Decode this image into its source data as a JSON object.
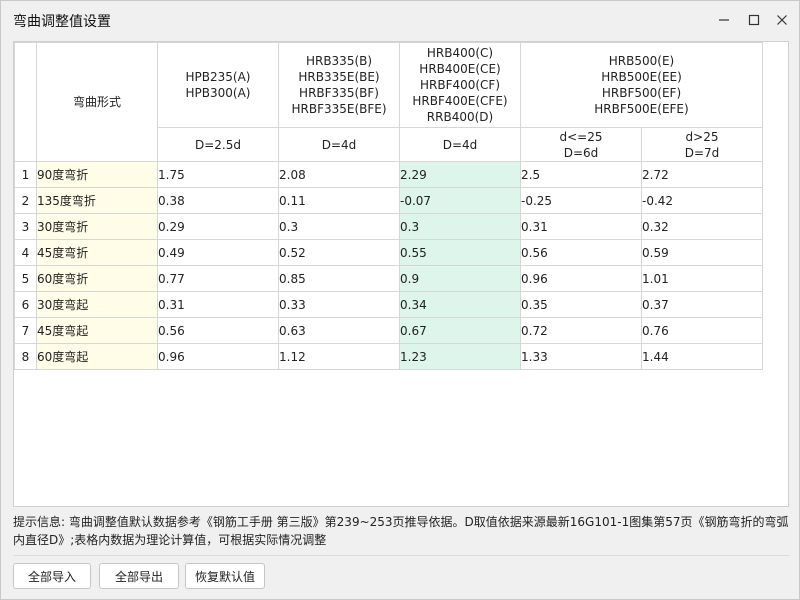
{
  "window": {
    "title": "弯曲调整值设置",
    "minimize_icon": "minimize-icon",
    "maximize_icon": "maximize-icon",
    "close_icon": "close-icon"
  },
  "table": {
    "form_header": "弯曲形式",
    "groups": [
      {
        "label": "HPB235(A)\nHPB300(A)"
      },
      {
        "label": "HRB335(B)\nHRB335E(BE)\nHRBF335(BF)\nHRBF335E(BFE)"
      },
      {
        "label": "HRB400(C)\nHRB400E(CE)\nHRBF400(CF)\nHRBF400E(CFE)\nRRB400(D)"
      },
      {
        "label": "HRB500(E)\nHRB500E(EE)\nHRBF500(EF)\nHRBF500E(EFE)"
      }
    ],
    "sub_headers": [
      "D=2.5d",
      "D=4d",
      "D=4d",
      "d<=25\nD=6d",
      "d>25\nD=7d"
    ],
    "rows": [
      {
        "num": "1",
        "form": "90度弯折",
        "values": [
          "1.75",
          "2.08",
          "2.29",
          "2.5",
          "2.72"
        ]
      },
      {
        "num": "2",
        "form": "135度弯折",
        "values": [
          "0.38",
          "0.11",
          "-0.07",
          "-0.25",
          "-0.42"
        ]
      },
      {
        "num": "3",
        "form": "30度弯折",
        "values": [
          "0.29",
          "0.3",
          "0.3",
          "0.31",
          "0.32"
        ]
      },
      {
        "num": "4",
        "form": "45度弯折",
        "values": [
          "0.49",
          "0.52",
          "0.55",
          "0.56",
          "0.59"
        ]
      },
      {
        "num": "5",
        "form": "60度弯折",
        "values": [
          "0.77",
          "0.85",
          "0.9",
          "0.96",
          "1.01"
        ]
      },
      {
        "num": "6",
        "form": "30度弯起",
        "values": [
          "0.31",
          "0.33",
          "0.34",
          "0.35",
          "0.37"
        ]
      },
      {
        "num": "7",
        "form": "45度弯起",
        "values": [
          "0.56",
          "0.63",
          "0.67",
          "0.72",
          "0.76"
        ]
      },
      {
        "num": "8",
        "form": "60度弯起",
        "values": [
          "0.96",
          "1.12",
          "1.23",
          "1.33",
          "1.44"
        ]
      }
    ],
    "highlight_column": 2,
    "colors": {
      "form_cell_bg": "#fffde8",
      "highlight_bg": "#ddf5ea",
      "grid_line": "#d6d6d6"
    }
  },
  "info_text": "提示信息: 弯曲调整值默认数据参考《钢筋工手册 第三版》第239~253页推导依据。D取值依据来源最新16G101-1图集第57页《钢筋弯折的弯弧内直径D》;表格内数据为理论计算值，可根据实际情况调整",
  "buttons": {
    "import_all": "全部导入",
    "export_all": "全部导出",
    "restore_default": "恢复默认值"
  }
}
